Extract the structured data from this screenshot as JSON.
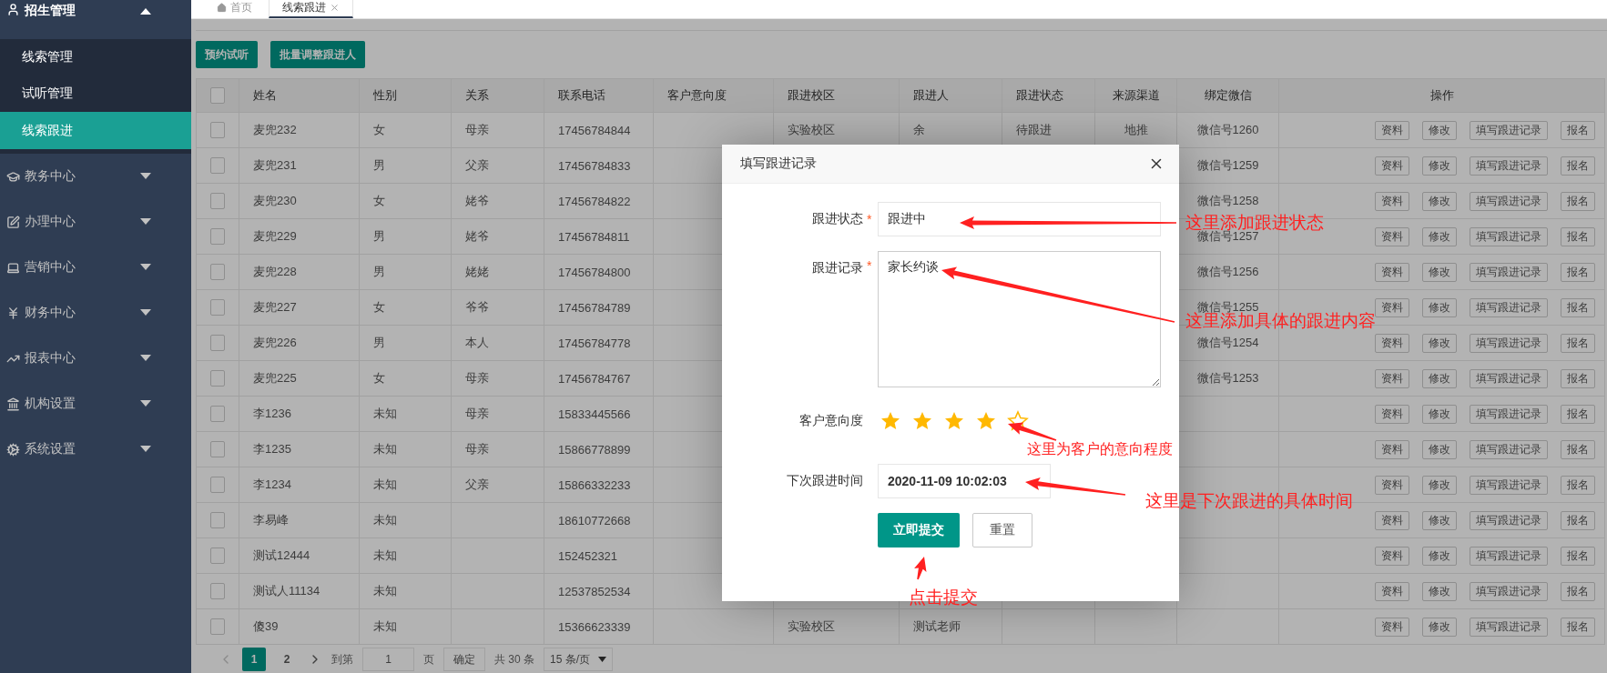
{
  "sidebar": {
    "items": [
      {
        "label": "招生管理",
        "expanded": true,
        "children": [
          {
            "label": "线索管理",
            "selected": false
          },
          {
            "label": "试听管理",
            "selected": false
          },
          {
            "label": "线索跟进",
            "selected": true
          }
        ]
      },
      {
        "label": "教务中心",
        "expanded": false
      },
      {
        "label": "办理中心",
        "expanded": false
      },
      {
        "label": "营销中心",
        "expanded": false
      },
      {
        "label": "财务中心",
        "expanded": false
      },
      {
        "label": "报表中心",
        "expanded": false
      },
      {
        "label": "机构设置",
        "expanded": false
      },
      {
        "label": "系统设置",
        "expanded": false
      }
    ]
  },
  "tabs": [
    {
      "label": "首页",
      "selected": false
    },
    {
      "label": "线索跟进",
      "selected": true
    }
  ],
  "toolbar": {
    "buttons": [
      "预约试听",
      "批量调整跟进人"
    ]
  },
  "table": {
    "header_checked": false,
    "columns": [
      "姓名",
      "性别",
      "关系",
      "联系电话",
      "客户意向度",
      "跟进校区",
      "跟进人",
      "跟进状态",
      "来源渠道",
      "绑定微信",
      "操作"
    ],
    "rows": [
      {
        "checked": false,
        "name": "麦兜232",
        "gender": "女",
        "relation": "母亲",
        "phone": "17456784844",
        "campus": "实验校区",
        "follower": "余",
        "status": "待跟进",
        "source": "地推",
        "wechat": "微信号1260",
        "actions": [
          "资料",
          "修改",
          "填写跟进记录",
          "报名"
        ]
      },
      {
        "checked": false,
        "name": "麦兜231",
        "gender": "男",
        "relation": "父亲",
        "phone": "17456784833",
        "wechat": "微信号1259",
        "actions": [
          "资料",
          "修改",
          "填写跟进记录",
          "报名"
        ]
      },
      {
        "checked": false,
        "name": "麦兜230",
        "gender": "女",
        "relation": "姥爷",
        "phone": "17456784822",
        "wechat": "微信号1258",
        "actions": [
          "资料",
          "修改",
          "填写跟进记录",
          "报名"
        ]
      },
      {
        "checked": false,
        "name": "麦兜229",
        "gender": "男",
        "relation": "姥爷",
        "phone": "17456784811",
        "wechat": "微信号1257",
        "actions": [
          "资料",
          "修改",
          "填写跟进记录",
          "报名"
        ]
      },
      {
        "checked": false,
        "name": "麦兜228",
        "gender": "男",
        "relation": "姥姥",
        "phone": "17456784800",
        "wechat": "微信号1256",
        "actions": [
          "资料",
          "修改",
          "填写跟进记录",
          "报名"
        ]
      },
      {
        "checked": false,
        "name": "麦兜227",
        "gender": "女",
        "relation": "爷爷",
        "phone": "17456784789",
        "wechat": "微信号1255",
        "actions": [
          "资料",
          "修改",
          "填写跟进记录",
          "报名"
        ]
      },
      {
        "checked": false,
        "name": "麦兜226",
        "gender": "男",
        "relation": "本人",
        "phone": "17456784778",
        "wechat": "微信号1254",
        "actions": [
          "资料",
          "修改",
          "填写跟进记录",
          "报名"
        ]
      },
      {
        "checked": false,
        "name": "麦兜225",
        "gender": "女",
        "relation": "母亲",
        "phone": "17456784767",
        "wechat": "微信号1253",
        "actions": [
          "资料",
          "修改",
          "填写跟进记录",
          "报名"
        ]
      },
      {
        "checked": false,
        "name": "李1236",
        "gender": "未知",
        "relation": "母亲",
        "phone": "15833445566",
        "actions": [
          "资料",
          "修改",
          "填写跟进记录",
          "报名"
        ]
      },
      {
        "checked": false,
        "name": "李1235",
        "gender": "未知",
        "relation": "母亲",
        "phone": "15866778899",
        "actions": [
          "资料",
          "修改",
          "填写跟进记录",
          "报名"
        ]
      },
      {
        "checked": false,
        "name": "李1234",
        "gender": "未知",
        "relation": "父亲",
        "phone": "15866332233",
        "actions": [
          "资料",
          "修改",
          "填写跟进记录",
          "报名"
        ]
      },
      {
        "checked": false,
        "name": "李易峰",
        "gender": "未知",
        "phone": "18610772668",
        "actions": [
          "资料",
          "修改",
          "填写跟进记录",
          "报名"
        ]
      },
      {
        "checked": false,
        "name": "测试12444",
        "gender": "未知",
        "phone": "152452321",
        "actions": [
          "资料",
          "修改",
          "填写跟进记录",
          "报名"
        ]
      },
      {
        "checked": false,
        "name": "测试人11134",
        "gender": "未知",
        "phone": "12537852534",
        "actions": [
          "资料",
          "修改",
          "填写跟进记录",
          "报名"
        ]
      },
      {
        "checked": false,
        "name": "傻39",
        "gender": "未知",
        "phone": "15366623339",
        "campus": "实验校区",
        "follower": "测试老师",
        "actions": [
          "资料",
          "修改",
          "填写跟进记录",
          "报名"
        ]
      }
    ]
  },
  "pagination": {
    "prev_disabled": true,
    "pages": [
      {
        "label": "1",
        "selected": true
      },
      {
        "label": "2",
        "selected": false
      }
    ],
    "goto_label": "到第",
    "goto_value": "1",
    "page_suffix": "页",
    "confirm": "确定",
    "total": "共 30 条",
    "page_size": "15 条/页"
  },
  "dialog": {
    "title": "填写跟进记录",
    "fields": [
      {
        "kind": "text",
        "label": "跟进状态",
        "marker": "*",
        "value": "跟进中"
      },
      {
        "kind": "textarea",
        "label": "跟进记录",
        "marker": "*",
        "value": "家长约谈"
      },
      {
        "kind": "rating",
        "label": "客户意向度",
        "stars": 4
      },
      {
        "kind": "datetime",
        "label": "下次跟进时间",
        "value": "2020-11-09 10:02:03"
      }
    ],
    "buttons": [
      {
        "kind": "primary",
        "label": "立即提交"
      },
      {
        "kind": "plain",
        "label": "重置"
      }
    ]
  },
  "annotations": [
    {
      "text": "这里添加跟进状态"
    },
    {
      "text": "这里添加具体的跟进内容"
    },
    {
      "text": "这里为客户的意向程度"
    },
    {
      "text": "这里是下次跟进的具体时间"
    },
    {
      "text": "点击提交"
    }
  ]
}
